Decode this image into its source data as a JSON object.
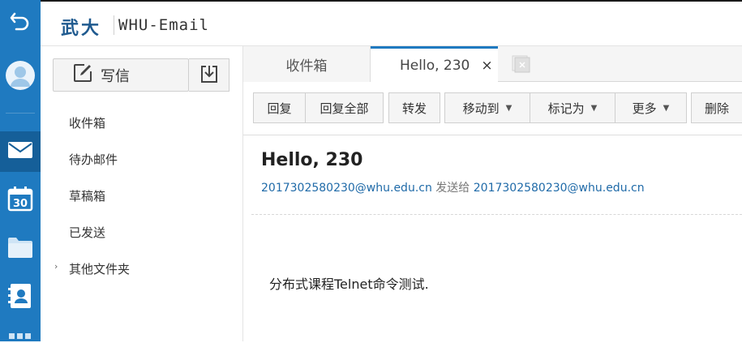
{
  "app": {
    "logo_cn": "武大",
    "logo_en": "WHU-Email"
  },
  "rail": {
    "items": [
      {
        "icon": "back-arrow-icon"
      },
      {
        "icon": "avatar-icon"
      },
      {
        "icon": "mail-icon",
        "active": true
      },
      {
        "icon": "calendar-icon",
        "label": "30"
      },
      {
        "icon": "folder-icon"
      },
      {
        "icon": "contacts-icon"
      },
      {
        "icon": "apps-grid-icon"
      }
    ]
  },
  "compose": {
    "label": "写信"
  },
  "folders": {
    "items": [
      {
        "label": "收件箱"
      },
      {
        "label": "待办邮件"
      },
      {
        "label": "草稿箱"
      },
      {
        "label": "已发送"
      },
      {
        "label": "其他文件夹",
        "expandable": true
      }
    ]
  },
  "tabs": {
    "inbox_label": "收件箱",
    "active_label": "Hello, 230",
    "close_label": "×"
  },
  "toolbar": {
    "reply": "回复",
    "reply_all": "回复全部",
    "forward": "转发",
    "move_to": "移动到",
    "mark_as": "标记为",
    "more": "更多",
    "delete": "删除"
  },
  "message": {
    "subject": "Hello, 230",
    "from": "2017302580230@whu.edu.cn",
    "sent_to_label": "发送给",
    "to": "2017302580230@whu.edu.cn",
    "body": "分布式课程Telnet命令测试."
  },
  "colors": {
    "rail_bg": "#1f7ac0",
    "rail_active": "#155f99",
    "accent": "#1f7ac0",
    "link": "#1f6aa8",
    "logo": "#1f5a8f"
  }
}
